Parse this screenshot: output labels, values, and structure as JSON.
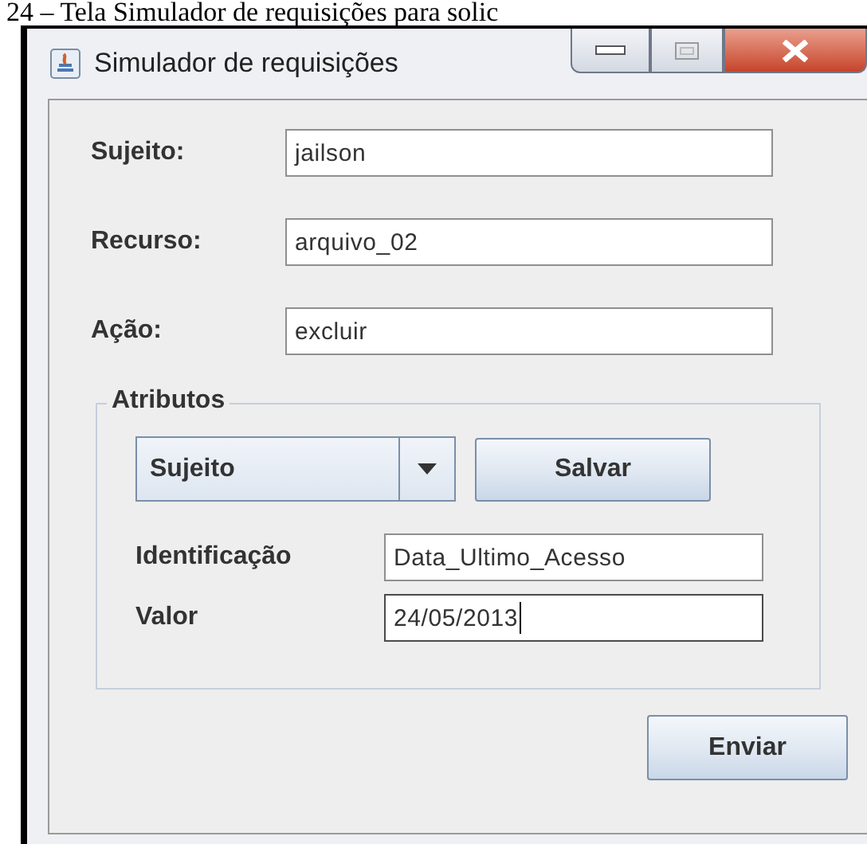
{
  "caption": "24 – Tela Simulador de requisições para solic",
  "window": {
    "title": "Simulador de requisições"
  },
  "fields": [
    {
      "label": "Sujeito:",
      "value": "jailson"
    },
    {
      "label": "Recurso:",
      "value": "arquivo_02"
    },
    {
      "label": "Ação:",
      "value": "excluir"
    }
  ],
  "attributes": {
    "title": "Atributos",
    "combo_value": "Sujeito",
    "save_button": "Salvar",
    "fields": [
      {
        "label": "Identificação",
        "value": "Data_Ultimo_Acesso",
        "focused": false
      },
      {
        "label": "Valor",
        "value": "24/05/2013",
        "focused": true
      }
    ]
  },
  "send_button": "Enviar"
}
